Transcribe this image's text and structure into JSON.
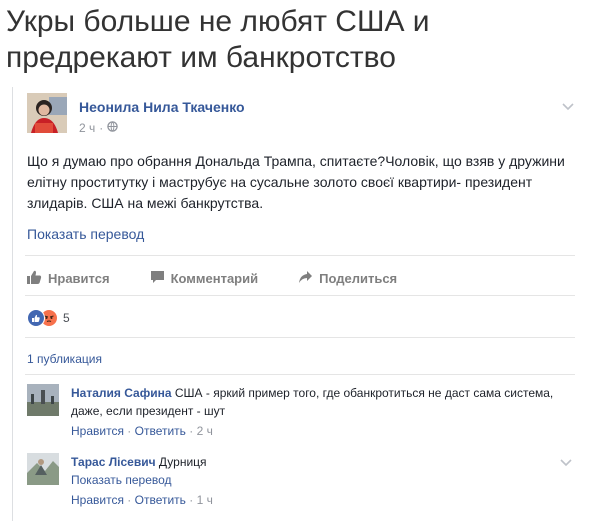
{
  "headline": "Укры больше не любят США и предрекают им банкротство",
  "post": {
    "author": "Неонила Нила Ткаченко",
    "time": "2 ч",
    "privacy_icon": "globe-icon",
    "text": "Що я думаю про обрання Дональда Трампа, спитаєте?Чоловік, що взяв у дружини елітну проститутку і маструбує на сусальне золото своєї квартири- президент злидарів. США на межі банкрутства.",
    "translate_label": "Показать перевод",
    "actions": {
      "like": "Нравится",
      "comment": "Комментарий",
      "share": "Поделиться"
    },
    "reactions": {
      "count": "5",
      "types": [
        "like-icon",
        "angry-icon"
      ]
    },
    "shares_label": "1 публикация"
  },
  "comments": [
    {
      "author": "Наталия Сафина",
      "text": "США - яркий пример того, где обанкротиться не даст сама система, даже, если президент - шут",
      "like": "Нравится",
      "reply": "Ответить",
      "sep": "·",
      "time": "2 ч"
    },
    {
      "author": "Тарас Лісевич",
      "text": "Дурниця",
      "translate_label": "Показать перевод",
      "like": "Нравится",
      "reply": "Ответить",
      "sep": "·",
      "time": "1 ч"
    }
  ],
  "colors": {
    "link": "#365899",
    "muted": "#90949c",
    "text": "#1d2129",
    "like_blue": "#4267b2",
    "angry_orange": "#f7714c"
  }
}
